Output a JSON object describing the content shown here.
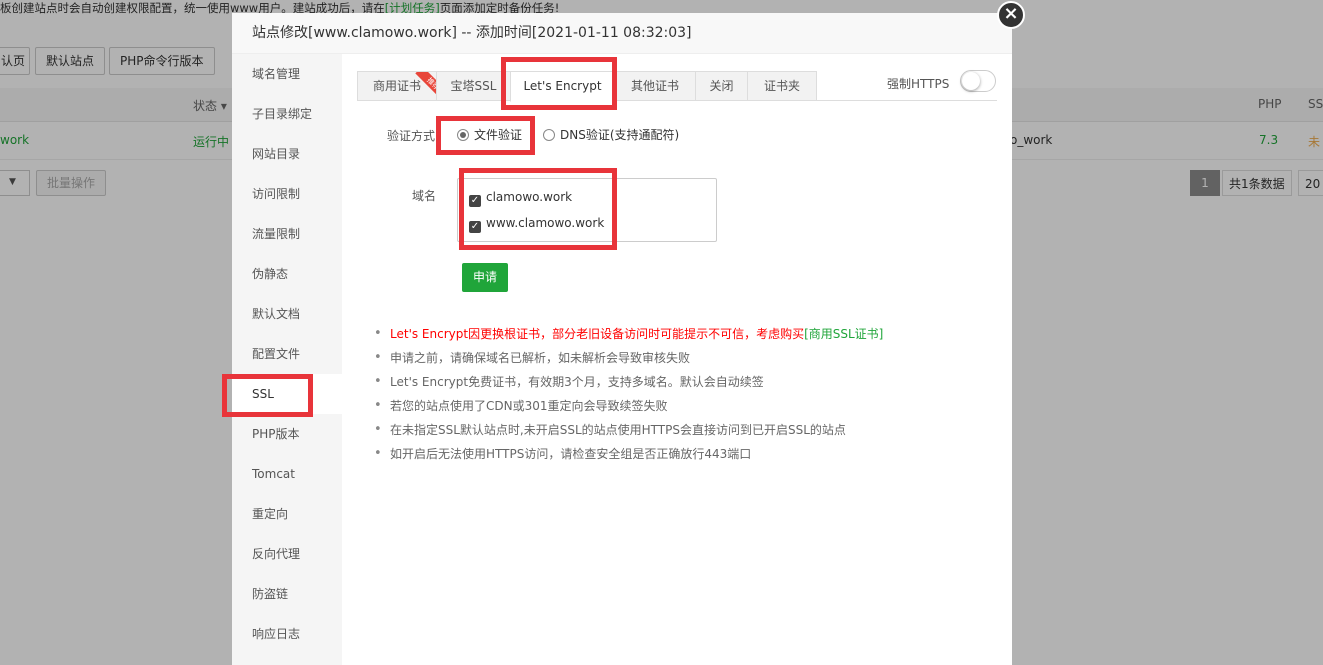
{
  "background": {
    "notice_text": "板创建站点时会自动创建权限配置，统一使用www用户。建站成功后，请在",
    "notice_link": "[计划任务]",
    "notice_tail": "页面添加定时备份任务!",
    "toolbar": [
      "认页",
      "默认站点",
      "PHP命令行版本"
    ],
    "col_status": "状态 ▾",
    "col_php": "PHP",
    "col_ssl": "SS",
    "row_name": "work",
    "row_status": "运行中",
    "row_path": "o_work",
    "row_php": "7.3",
    "row_ssl": "未",
    "batch": "批量操作",
    "page_num": "1",
    "total": "共1条数据",
    "per_page": "20"
  },
  "modal": {
    "title": "站点修改[www.clamowo.work] -- 添加时间[2021-01-11 08:32:03]",
    "close": "×"
  },
  "sidebar": {
    "items": [
      "域名管理",
      "子目录绑定",
      "网站目录",
      "访问限制",
      "流量限制",
      "伪静态",
      "默认文档",
      "配置文件",
      "SSL",
      "PHP版本",
      "Tomcat",
      "重定向",
      "反向代理",
      "防盗链",
      "响应日志"
    ]
  },
  "tabs": [
    "商用证书",
    "宝塔SSL",
    "Let's Encrypt",
    "其他证书",
    "关闭",
    "证书夹"
  ],
  "recommend_badge": "推荐",
  "force_https_label": "强制HTTPS",
  "verify": {
    "label": "验证方式",
    "file": "文件验证",
    "dns": "DNS验证(支持通配符)"
  },
  "domain": {
    "label": "域名",
    "items": [
      "clamowo.work",
      "www.clamowo.work"
    ]
  },
  "apply_label": "申请",
  "notes": {
    "warn_text": "Let's Encrypt因更换根证书，部分老旧设备访问时可能提示不可信，考虑购买",
    "warn_link": "[商用SSL证书]",
    "items": [
      "申请之前，请确保域名已解析，如未解析会导致审核失败",
      "Let's Encrypt免费证书，有效期3个月，支持多域名。默认会自动续签",
      "若您的站点使用了CDN或301重定向会导致续签失败",
      "在未指定SSL默认站点时,未开启SSL的站点使用HTTPS会直接访问到已开启SSL的站点",
      "如开启后无法使用HTTPS访问，请检查安全组是否正确放行443端口"
    ]
  },
  "colors": {
    "accent": "#20a53a",
    "highlight": "#e8343a",
    "warning": "#ff0000"
  }
}
